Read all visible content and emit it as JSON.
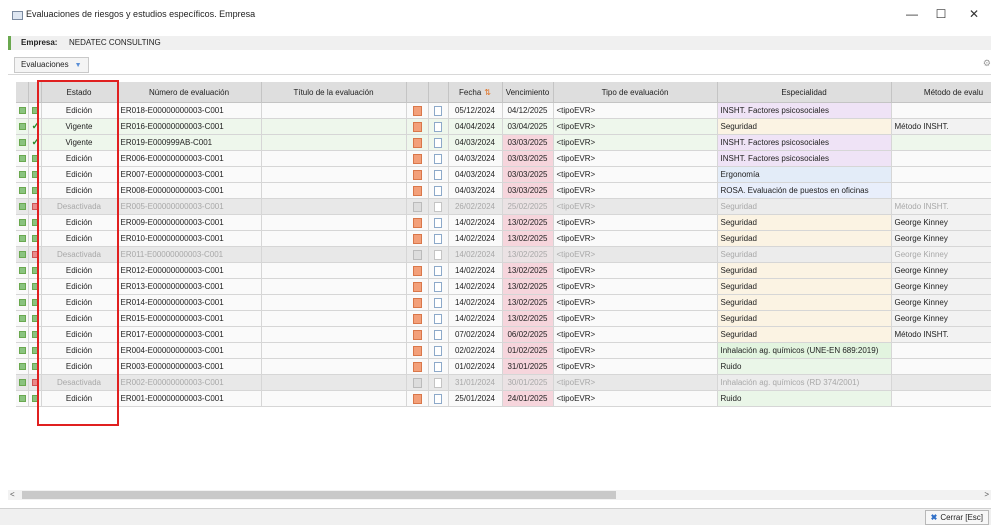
{
  "window": {
    "title": "Evaluaciones de riesgos y estudios específicos. Empresa",
    "minimize": "—",
    "maximize": "☐",
    "close": "✕"
  },
  "empresa": {
    "label": "Empresa:",
    "value": "NEDATEC CONSULTING"
  },
  "toolbar": {
    "evaluaciones_label": "Evaluaciones",
    "dropdown_glyph": "▼",
    "settings_glyph": "⚙"
  },
  "columns": [
    "",
    "",
    "Estado",
    "Número de evaluación",
    "Título de la evaluación",
    "",
    "",
    "Fecha",
    "Vencimiento",
    "Tipo de evaluación",
    "Especialidad",
    "Método de evalu"
  ],
  "fecha_sort_glyph": "⇅",
  "rows": [
    {
      "estado": "Edición",
      "numero": "ER018-E00000000003-C001",
      "titulo": "",
      "fecha": "05/12/2024",
      "vencimiento": "04/12/2025",
      "tipo": "<tipoEVR>",
      "especialidad": "INSHT. Factores psicosociales",
      "metodo": "",
      "status": "edicion",
      "venc_red": false,
      "esp": "psico"
    },
    {
      "estado": "Vigente",
      "numero": "ER016-E00000000003-C001",
      "titulo": "",
      "fecha": "04/04/2024",
      "vencimiento": "03/04/2025",
      "tipo": "<tipoEVR>",
      "especialidad": "Seguridad",
      "metodo": "Método INSHT.",
      "status": "vigente",
      "venc_red": false,
      "esp": "seg"
    },
    {
      "estado": "Vigente",
      "numero": "ER019-E000999AB-C001",
      "titulo": "",
      "fecha": "04/03/2024",
      "vencimiento": "03/03/2025",
      "tipo": "<tipoEVR>",
      "especialidad": "INSHT. Factores psicosociales",
      "metodo": "",
      "status": "vigente",
      "venc_red": true,
      "esp": "psico"
    },
    {
      "estado": "Edición",
      "numero": "ER006-E00000000003-C001",
      "titulo": "",
      "fecha": "04/03/2024",
      "vencimiento": "03/03/2025",
      "tipo": "<tipoEVR>",
      "especialidad": "INSHT. Factores psicosociales",
      "metodo": "",
      "status": "edicion",
      "venc_red": true,
      "esp": "psico"
    },
    {
      "estado": "Edición",
      "numero": "ER007-E00000000003-C001",
      "titulo": "",
      "fecha": "04/03/2024",
      "vencimiento": "03/03/2025",
      "tipo": "<tipoEVR>",
      "especialidad": "Ergonomía",
      "metodo": "",
      "status": "edicion",
      "venc_red": true,
      "esp": "ergo"
    },
    {
      "estado": "Edición",
      "numero": "ER008-E00000000003-C001",
      "titulo": "",
      "fecha": "04/03/2024",
      "vencimiento": "03/03/2025",
      "tipo": "<tipoEVR>",
      "especialidad": "ROSA. Evaluación de puestos en oficinas",
      "metodo": "",
      "status": "edicion",
      "venc_red": true,
      "esp": "rosa"
    },
    {
      "estado": "Desactivada",
      "numero": "ER005-E00000000003-C001",
      "titulo": "",
      "fecha": "26/02/2024",
      "vencimiento": "25/02/2025",
      "tipo": "<tipoEVR>",
      "especialidad": "Seguridad",
      "metodo": "Método INSHT.",
      "status": "desactivada",
      "venc_red": true,
      "esp": "seg"
    },
    {
      "estado": "Edición",
      "numero": "ER009-E00000000003-C001",
      "titulo": "",
      "fecha": "14/02/2024",
      "vencimiento": "13/02/2025",
      "tipo": "<tipoEVR>",
      "especialidad": "Seguridad",
      "metodo": "George Kinney",
      "status": "edicion",
      "venc_red": true,
      "esp": "seg"
    },
    {
      "estado": "Edición",
      "numero": "ER010-E00000000003-C001",
      "titulo": "",
      "fecha": "14/02/2024",
      "vencimiento": "13/02/2025",
      "tipo": "<tipoEVR>",
      "especialidad": "Seguridad",
      "metodo": "George Kinney",
      "status": "edicion",
      "venc_red": true,
      "esp": "seg"
    },
    {
      "estado": "Desactivada",
      "numero": "ER011-E00000000003-C001",
      "titulo": "",
      "fecha": "14/02/2024",
      "vencimiento": "13/02/2025",
      "tipo": "<tipoEVR>",
      "especialidad": "Seguridad",
      "metodo": "George Kinney",
      "status": "desactivada",
      "venc_red": true,
      "esp": "seg"
    },
    {
      "estado": "Edición",
      "numero": "ER012-E00000000003-C001",
      "titulo": "",
      "fecha": "14/02/2024",
      "vencimiento": "13/02/2025",
      "tipo": "<tipoEVR>",
      "especialidad": "Seguridad",
      "metodo": "George Kinney",
      "status": "edicion",
      "venc_red": true,
      "esp": "seg"
    },
    {
      "estado": "Edición",
      "numero": "ER013-E00000000003-C001",
      "titulo": "",
      "fecha": "14/02/2024",
      "vencimiento": "13/02/2025",
      "tipo": "<tipoEVR>",
      "especialidad": "Seguridad",
      "metodo": "George Kinney",
      "status": "edicion",
      "venc_red": true,
      "esp": "seg"
    },
    {
      "estado": "Edición",
      "numero": "ER014-E00000000003-C001",
      "titulo": "",
      "fecha": "14/02/2024",
      "vencimiento": "13/02/2025",
      "tipo": "<tipoEVR>",
      "especialidad": "Seguridad",
      "metodo": "George Kinney",
      "status": "edicion",
      "venc_red": true,
      "esp": "seg"
    },
    {
      "estado": "Edición",
      "numero": "ER015-E00000000003-C001",
      "titulo": "",
      "fecha": "14/02/2024",
      "vencimiento": "13/02/2025",
      "tipo": "<tipoEVR>",
      "especialidad": "Seguridad",
      "metodo": "George Kinney",
      "status": "edicion",
      "venc_red": true,
      "esp": "seg"
    },
    {
      "estado": "Edición",
      "numero": "ER017-E00000000003-C001",
      "titulo": "",
      "fecha": "07/02/2024",
      "vencimiento": "06/02/2025",
      "tipo": "<tipoEVR>",
      "especialidad": "Seguridad",
      "metodo": "Método INSHT.",
      "status": "edicion",
      "venc_red": true,
      "esp": "seg"
    },
    {
      "estado": "Edición",
      "numero": "ER004-E00000000003-C001",
      "titulo": "",
      "fecha": "02/02/2024",
      "vencimiento": "01/02/2025",
      "tipo": "<tipoEVR>",
      "especialidad": "Inhalación ag. químicos (UNE-EN 689:2019)",
      "metodo": "",
      "status": "edicion",
      "venc_red": true,
      "esp": "inh"
    },
    {
      "estado": "Edición",
      "numero": "ER003-E00000000003-C001",
      "titulo": "",
      "fecha": "01/02/2024",
      "vencimiento": "31/01/2025",
      "tipo": "<tipoEVR>",
      "especialidad": "Ruido",
      "metodo": "",
      "status": "edicion",
      "venc_red": true,
      "esp": "ruido"
    },
    {
      "estado": "Desactivada",
      "numero": "ER002-E00000000003-C001",
      "titulo": "",
      "fecha": "31/01/2024",
      "vencimiento": "30/01/2025",
      "tipo": "<tipoEVR>",
      "especialidad": "Inhalación ag. químicos (RD 374/2001)",
      "metodo": "",
      "status": "desactivada",
      "venc_red": true,
      "esp": "inh"
    },
    {
      "estado": "Edición",
      "numero": "ER001-E00000000003-C001",
      "titulo": "",
      "fecha": "25/01/2024",
      "vencimiento": "24/01/2025",
      "tipo": "<tipoEVR>",
      "especialidad": "Ruido",
      "metodo": "",
      "status": "edicion",
      "venc_red": true,
      "esp": "ruido"
    }
  ],
  "scroll": {
    "left_arrow": "<",
    "right_arrow": ">"
  },
  "footer": {
    "close_label": "Cerrar [Esc]",
    "close_glyph": "✖"
  },
  "colors": {
    "accent_green": "#6aa84f",
    "highlight_red": "#e02020",
    "venc_red_bg": "#f6d5dc",
    "link_blue": "#2f6fc7"
  }
}
